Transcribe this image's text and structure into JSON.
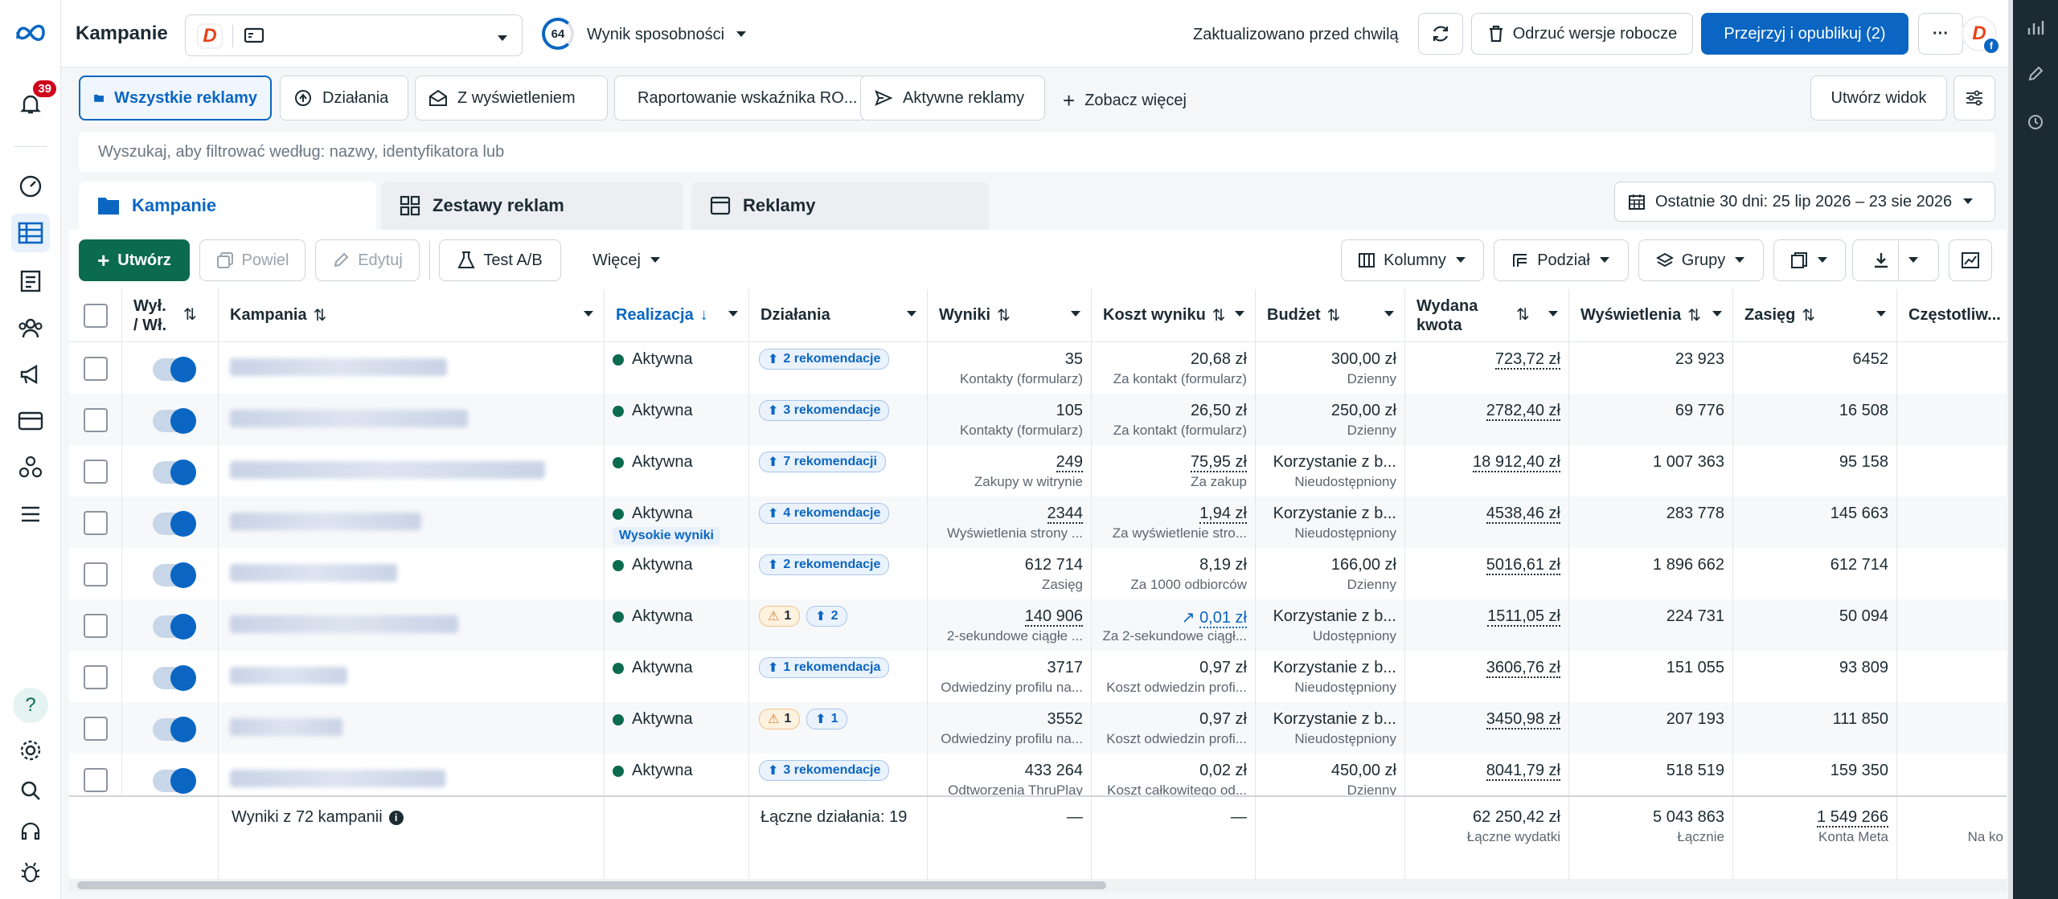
{
  "header": {
    "title": "Kampanie",
    "score": "64",
    "score_label": "Wynik sposobności",
    "updated": "Zaktualizowano przed chwilą",
    "discard": "Odrzuć wersje robocze",
    "publish": "Przejrzyj i opublikuj (2)",
    "more": "···",
    "logo_letter": "D",
    "notifications": "39"
  },
  "views": {
    "tabs": [
      "Wszystkie reklamy",
      "Działania",
      "Z wyświetleniem",
      "Raportowanie wskaźnika RO...",
      "Aktywne reklamy"
    ],
    "see_more": "Zobacz więcej",
    "create_view": "Utwórz widok"
  },
  "search": {
    "placeholder": "Wyszukaj, aby filtrować według: nazwy, identyfikatora lub"
  },
  "levels": {
    "campaigns": "Kampanie",
    "adsets": "Zestawy reklam",
    "ads": "Reklamy"
  },
  "date_range": "Ostatnie 30 dni: 25 lip 2026 – 23 sie 2026",
  "toolbar": {
    "create": "Utwórz",
    "duplicate": "Powiel",
    "edit": "Edytuj",
    "ab_test": "Test A/B",
    "more": "Więcej",
    "columns": "Kolumny",
    "breakdown": "Podział",
    "groups": "Grupy"
  },
  "columns": {
    "onoff_line1": "Wył.",
    "onoff_line2": "/ Wł.",
    "campaign": "Kampania",
    "delivery": "Realizacja",
    "actions": "Działania",
    "results": "Wyniki",
    "cost": "Koszt wyniku",
    "budget": "Budżet",
    "spent_line1": "Wydana",
    "spent_line2": "kwota",
    "impressions": "Wyświetlenia",
    "reach": "Zasięg",
    "frequency": "Częstotliw..."
  },
  "rows": [
    {
      "status": "Aktywna",
      "action": "2 rekomendacje",
      "result": "35",
      "result_sub": "Kontakty (formularz)",
      "cost": "20,68 zł",
      "cost_sub": "Za kontakt (formularz)",
      "budget": "300,00 zł",
      "budget_sub": "Dzienny",
      "spent": "723,72 zł",
      "impressions": "23 923",
      "reach": "6452"
    },
    {
      "status": "Aktywna",
      "action": "3 rekomendacje",
      "result": "105",
      "result_sub": "Kontakty (formularz)",
      "cost": "26,50 zł",
      "cost_sub": "Za kontakt (formularz)",
      "budget": "250,00 zł",
      "budget_sub": "Dzienny",
      "spent": "2782,40 zł",
      "impressions": "69 776",
      "reach": "16 508"
    },
    {
      "status": "Aktywna",
      "action": "7 rekomendacji",
      "result": "249",
      "result_sub": "Zakupy w witrynie",
      "cost": "75,95 zł",
      "cost_sub": "Za zakup",
      "budget": "Korzystanie z b...",
      "budget_sub": "Nieudostępniony",
      "spent": "18 912,40 zł",
      "impressions": "1 007 363",
      "reach": "95 158"
    },
    {
      "status": "Aktywna",
      "badge": "Wysokie wyniki",
      "action": "4 rekomendacje",
      "result": "2344",
      "result_sub": "Wyświetlenia strony ...",
      "cost": "1,94 zł",
      "cost_sub": "Za wyświetlenie stro...",
      "budget": "Korzystanie z b...",
      "budget_sub": "Nieudostępniony",
      "spent": "4538,46 zł",
      "impressions": "283 778",
      "reach": "145 663"
    },
    {
      "status": "Aktywna",
      "action": "2 rekomendacje",
      "result": "612 714",
      "result_sub": "Zasięg",
      "cost": "8,19 zł",
      "cost_sub": "Za 1000 odbiorców",
      "budget": "166,00 zł",
      "budget_sub": "Dzienny",
      "spent": "5016,61 zł",
      "impressions": "1 896 662",
      "reach": "612 714"
    },
    {
      "status": "Aktywna",
      "warn": "1",
      "action_count": "2",
      "result": "140 906",
      "result_sub": "2-sekundowe ciągłe ...",
      "cost": "0,01 zł",
      "cost_sub": "Za 2-sekundowe ciągł...",
      "budget": "Korzystanie z b...",
      "budget_sub": "Udostępniony",
      "spent": "1511,05 zł",
      "impressions": "224 731",
      "reach": "50 094"
    },
    {
      "status": "Aktywna",
      "action": "1 rekomendacja",
      "result": "3717",
      "result_sub": "Odwiedziny profilu na...",
      "cost": "0,97 zł",
      "cost_sub": "Koszt odwiedzin profi...",
      "budget": "Korzystanie z b...",
      "budget_sub": "Nieudostępniony",
      "spent": "3606,76 zł",
      "impressions": "151 055",
      "reach": "93 809"
    },
    {
      "status": "Aktywna",
      "warn": "1",
      "action_count": "1",
      "result": "3552",
      "result_sub": "Odwiedziny profilu na...",
      "cost": "0,97 zł",
      "cost_sub": "Koszt odwiedzin profi...",
      "budget": "Korzystanie z b...",
      "budget_sub": "Nieudostępniony",
      "spent": "3450,98 zł",
      "impressions": "207 193",
      "reach": "111 850"
    },
    {
      "status": "Aktywna",
      "action": "3 rekomendacje",
      "result": "433 264",
      "result_sub": "Odtworzenia ThruPlay",
      "cost": "0,02 zł",
      "cost_sub": "Koszt całkowitego od...",
      "budget": "450,00 zł",
      "budget_sub": "Dzienny",
      "spent": "8041,79 zł",
      "impressions": "518 519",
      "reach": "159 350"
    }
  ],
  "footer": {
    "results_label": "Wyniki z 72 kampanii",
    "actions_total": "Łączne działania: 19",
    "dash": "—",
    "spent_total": "62 250,42 zł",
    "spent_sub": "Łączne wydatki",
    "impr_total": "5 043 863",
    "impr_sub": "Łącznie",
    "reach_total": "1 549 266",
    "reach_sub": "Konta Meta",
    "freq_sub": "Na ko"
  }
}
